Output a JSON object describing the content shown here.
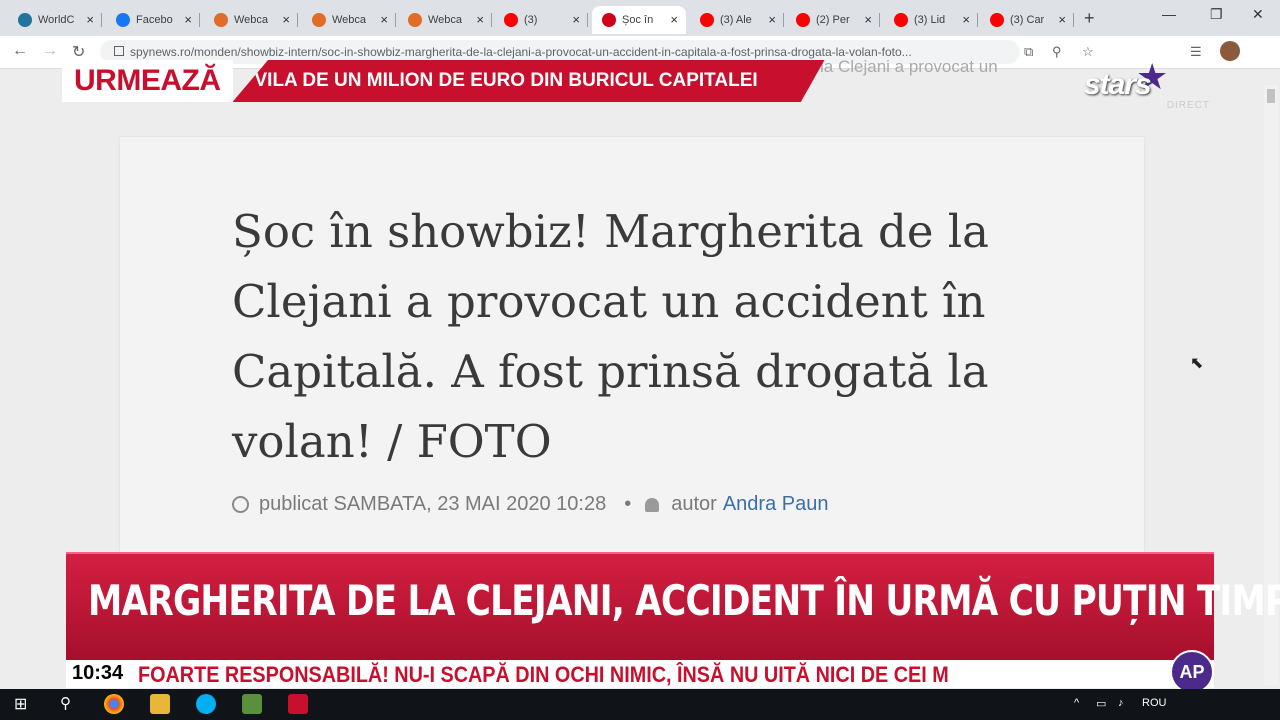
{
  "browser": {
    "tabs": [
      {
        "title": "WorldC",
        "icon": "wordpress-icon",
        "color": "#21759b"
      },
      {
        "title": "Facebo",
        "icon": "facebook-icon",
        "color": "#1877f2"
      },
      {
        "title": "Webca",
        "icon": "webcam-icon",
        "color": "#e06c2a"
      },
      {
        "title": "Webca",
        "icon": "webcam-icon",
        "color": "#e06c2a"
      },
      {
        "title": "Webca",
        "icon": "webcam-icon",
        "color": "#e06c2a"
      },
      {
        "title": "(3)",
        "icon": "youtube-icon",
        "color": "#ff0000"
      },
      {
        "title": "Șoc în",
        "icon": "spynews-icon",
        "color": "#d0021b",
        "active": true
      },
      {
        "title": "(3) Ale",
        "icon": "youtube-icon",
        "color": "#ff0000"
      },
      {
        "title": "(2) Per",
        "icon": "youtube-icon",
        "color": "#ff0000"
      },
      {
        "title": "(3) Lid",
        "icon": "youtube-icon",
        "color": "#ff0000"
      },
      {
        "title": "(3) Car",
        "icon": "youtube-icon",
        "color": "#ff0000"
      }
    ],
    "url": "spynews.ro/monden/showbiz-intern/soc-in-showbiz-margherita-de-la-clejani-a-provocat-un-accident-in-capitala-a-fost-prinsa-drogata-la-volan-foto..."
  },
  "article": {
    "ghost_text": "la Clejani a provocat un",
    "headline": "Șoc în showbiz! Margherita de la Clejani a provocat un accident în Capitală. A fost prinsă drogată la volan! / FOTO",
    "published": "publicat SAMBATA, 23 MAI 2020 10:28",
    "separator": "•",
    "author_label": "autor",
    "author_name": "Andra Paun"
  },
  "overlay": {
    "next_label": "URMEAZĂ",
    "next_text": "VILA DE UN MILION DE EURO DIN BURICUL CAPITALEI",
    "channel": "stars",
    "channel_sub": "DIRECT",
    "lower_title": "MARGHERITA DE LA CLEJANI, ACCIDENT ÎN URMĂ CU PUȚIN TIMP",
    "time": "10:34",
    "ticker": "FOARTE RESPONSABILĂ! NU-I SCAPĂ DIN OCHI NIMIC, ÎNSĂ NU UITĂ NICI DE CEI M",
    "ap_logo": "AP",
    "accent_color": "#c8102e"
  },
  "taskbar": {
    "language": "ROU"
  }
}
